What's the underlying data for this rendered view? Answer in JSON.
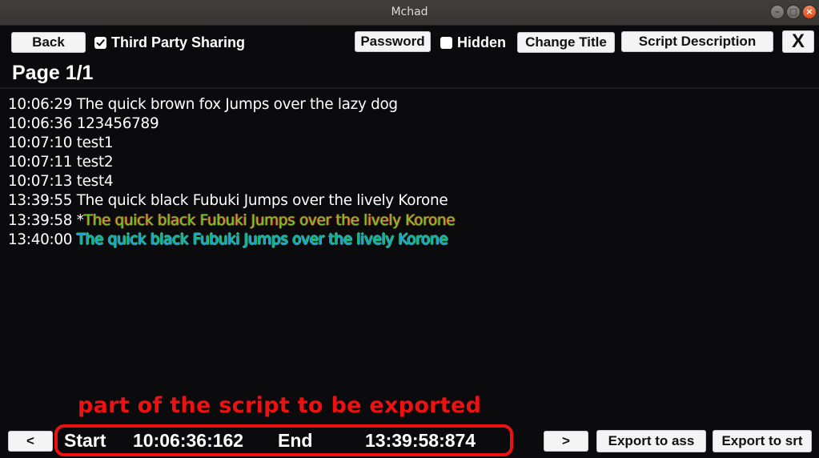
{
  "window": {
    "title": "Mchad"
  },
  "toolbar": {
    "back_label": "Back",
    "third_party_label": "Third Party Sharing",
    "third_party_checked": true,
    "password_label": "Password",
    "hidden_label": "Hidden",
    "hidden_checked": false,
    "change_title_label": "Change Title",
    "script_description_label": "Script Description",
    "close_label": "X"
  },
  "page": {
    "title": "Page 1/1"
  },
  "script_lines": [
    {
      "time": "10:06:29",
      "prefix": "",
      "text": "The quick brown fox Jumps over the lazy dog",
      "style": "white"
    },
    {
      "time": "10:06:36",
      "prefix": "",
      "text": "123456789",
      "style": "white"
    },
    {
      "time": "10:07:10",
      "prefix": "",
      "text": "test1",
      "style": "white"
    },
    {
      "time": "10:07:11",
      "prefix": "",
      "text": "test2",
      "style": "white"
    },
    {
      "time": "10:07:13",
      "prefix": "",
      "text": "test4",
      "style": "white"
    },
    {
      "time": "13:39:55",
      "prefix": "",
      "text": "The quick black Fubuki Jumps over the lively Korone",
      "style": "white"
    },
    {
      "time": "13:39:58",
      "prefix": "*",
      "text": "The quick black Fubuki Jumps over the lively Korone",
      "style": "green"
    },
    {
      "time": "13:40:00",
      "prefix": "",
      "text": "The quick black Fubuki Jumps over the lively Korone",
      "style": "blue"
    }
  ],
  "annotation": {
    "text": "part of the script to be exported"
  },
  "footer": {
    "prev_label": "<",
    "next_label": ">",
    "start_label": "Start",
    "start_value": "10:06:36:162",
    "end_label": "End",
    "end_value": "13:39:58:874",
    "export_ass_label": "Export to ass",
    "export_srt_label": "Export to srt"
  },
  "colors": {
    "annotation_red": "#ee1111",
    "green_text": "#6bd12a",
    "blue_text": "#1f9be6",
    "background": "#0b0b0e"
  }
}
